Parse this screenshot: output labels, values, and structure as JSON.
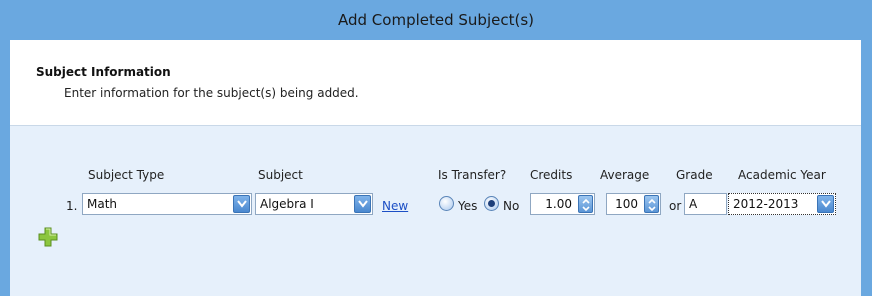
{
  "window": {
    "title": "Add Completed Subject(s)"
  },
  "info": {
    "title": "Subject Information",
    "description": "Enter information for the subject(s) being added."
  },
  "columns": {
    "subject_type": "Subject Type",
    "subject": "Subject",
    "is_transfer": "Is Transfer?",
    "credits": "Credits",
    "average": "Average",
    "grade": "Grade",
    "academic_year": "Academic Year"
  },
  "rows": [
    {
      "number": "1.",
      "subject_type": "Math",
      "subject": "Algebra I",
      "new_link": "New",
      "transfer_yes": "Yes",
      "transfer_no": "No",
      "transfer_selected": "No",
      "credits": "1.00",
      "average": "100",
      "or_label": "or",
      "grade": "A",
      "academic_year": "2012-2013"
    }
  ],
  "icons": {
    "dropdown": "chevron-down-icon",
    "spinner": "spinner-icon",
    "add": "plus-icon"
  },
  "colors": {
    "titlebar": "#6aa8e0",
    "panel_bg": "#e6f0fb",
    "link": "#1c4fc5",
    "add_icon": "#8cc63f"
  }
}
